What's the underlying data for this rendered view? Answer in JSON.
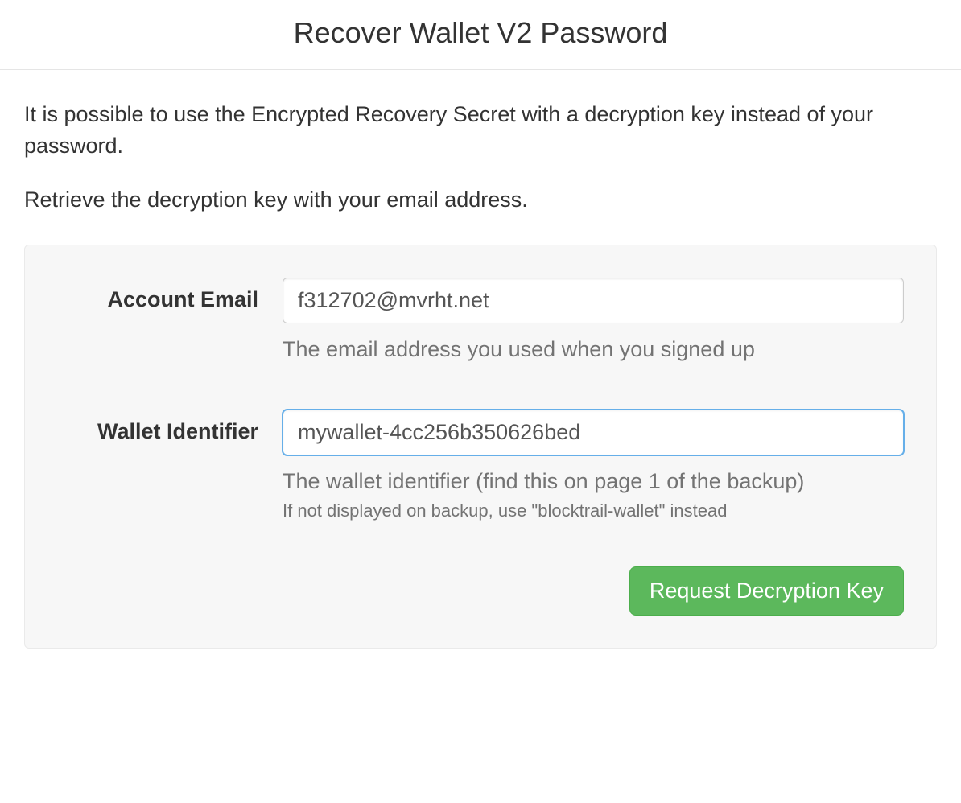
{
  "header": {
    "title": "Recover Wallet V2 Password"
  },
  "intro": {
    "line1": "It is possible to use the Encrypted Recovery Secret with a decryption key instead of your password.",
    "line2": "Retrieve the decryption key with your email address."
  },
  "form": {
    "email": {
      "label": "Account Email",
      "value": "f312702@mvrht.net",
      "help": "The email address you used when you signed up"
    },
    "wallet": {
      "label": "Wallet Identifier",
      "value": "mywallet-4cc256b350626bed",
      "help": "The wallet identifier (find this on page 1 of the backup)",
      "subhelp": "If not displayed on backup, use \"blocktrail-wallet\" instead"
    },
    "submit_label": "Request Decryption Key"
  }
}
